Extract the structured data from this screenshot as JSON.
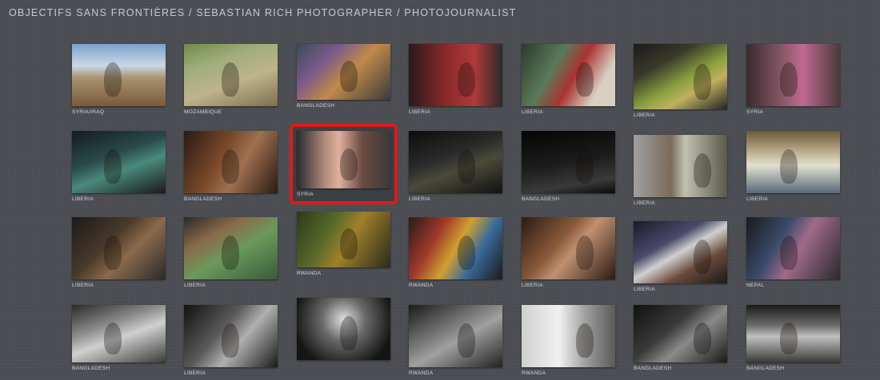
{
  "site": {
    "title": "OBJECTIFS SANS FRONTIÈRES / SEBASTIAN RICH PHOTOGRAPHER / PHOTOJOURNALIST"
  },
  "gallery": {
    "rows": [
      {
        "items": [
          {
            "caption": "SYRIA/IRAQ",
            "fill": "g-sky"
          },
          {
            "caption": "MOZAMBIQUE",
            "fill": "g-green"
          },
          {
            "caption": "BANGLADESH",
            "fill": "g-crowd"
          },
          {
            "caption": "LIBERIA",
            "fill": "g-red"
          },
          {
            "caption": "LIBERIA",
            "fill": "g-hosp"
          },
          {
            "caption": "LIBERIA",
            "fill": "g-bed"
          },
          {
            "caption": "Syria",
            "fill": "g-women"
          }
        ]
      },
      {
        "items": [
          {
            "caption": "LIBERIA",
            "fill": "g-dark-teal"
          },
          {
            "caption": "BANGLADESH",
            "fill": "g-kids"
          },
          {
            "caption": "SYRIA",
            "fill": "g-girls",
            "highlighted": true
          },
          {
            "caption": "LIBERIA",
            "fill": "g-dark"
          },
          {
            "caption": "BANGLADESH",
            "fill": "g-darker"
          },
          {
            "caption": "LIBERIA",
            "fill": "g-street"
          },
          {
            "caption": "LIBERIA",
            "fill": "g-tent"
          }
        ]
      },
      {
        "items": [
          {
            "caption": "LIBERIA",
            "fill": "g-room"
          },
          {
            "caption": "LIBERIA",
            "fill": "g-water"
          },
          {
            "caption": "RWANDA",
            "fill": "g-jungle"
          },
          {
            "caption": "RWANDA",
            "fill": "g-colorful"
          },
          {
            "caption": "LIBERIA",
            "fill": "g-cry"
          },
          {
            "caption": "LIBERIA",
            "fill": "g-net"
          },
          {
            "caption": "NEPAL",
            "fill": "g-nepal"
          }
        ]
      },
      {
        "items": [
          {
            "caption": "BANGLADESH",
            "fill": "g-bw1"
          },
          {
            "caption": "LIBERIA",
            "fill": "g-bw2"
          },
          {
            "caption": "",
            "fill": "g-bw3"
          },
          {
            "caption": "RWANDA",
            "fill": "g-bw4"
          },
          {
            "caption": "RWANDA",
            "fill": "g-bw5"
          },
          {
            "caption": "BANGLADESH",
            "fill": "g-bw6"
          },
          {
            "caption": "BANGLADESH",
            "fill": "g-bw7"
          }
        ]
      }
    ]
  },
  "colors": {
    "background": "#4a4d52",
    "highlight_border": "#e01a1a",
    "title_text": "#c8cacd",
    "caption_text": "#d4d6d8"
  }
}
